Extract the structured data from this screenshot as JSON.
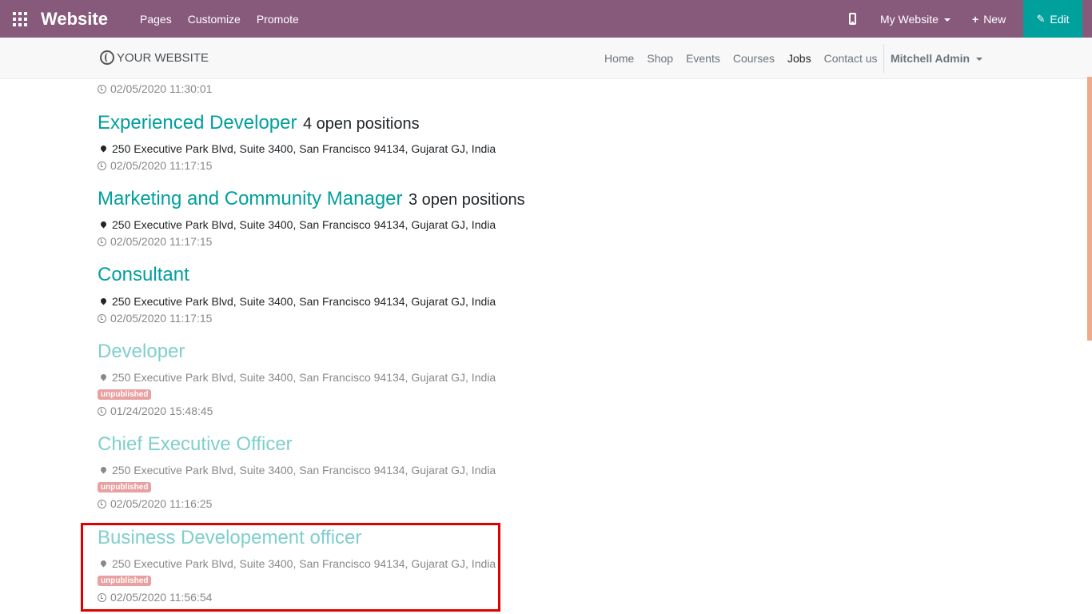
{
  "topbar": {
    "app_title": "Website",
    "menu": [
      "Pages",
      "Customize",
      "Promote"
    ],
    "website_selector": "My Website",
    "new_label": "New",
    "edit_label": "Edit",
    "icons": [
      "apps-icon",
      "mobile-icon",
      "plus-icon",
      "pencil-icon",
      "caret-down-icon"
    ]
  },
  "header": {
    "logo_text": "YOUR WEBSITE",
    "nav": [
      "Home",
      "Shop",
      "Events",
      "Courses",
      "Jobs",
      "Contact us"
    ],
    "active_nav": "Jobs",
    "user": "Mitchell Admin"
  },
  "partial_top_date": "02/05/2020 11:30:01",
  "jobs": [
    {
      "title": "Experienced Developer",
      "positions": "4 open positions",
      "address": "250 Executive Park Blvd, Suite 3400, San Francisco 94134, Gujarat GJ, India",
      "date": "02/05/2020 11:17:15",
      "published": true
    },
    {
      "title": "Marketing and Community Manager",
      "positions": "3 open positions",
      "address": "250 Executive Park Blvd, Suite 3400, San Francisco 94134, Gujarat GJ, India",
      "date": "02/05/2020 11:17:15",
      "published": true
    },
    {
      "title": "Consultant",
      "positions": "",
      "address": "250 Executive Park Blvd, Suite 3400, San Francisco 94134, Gujarat GJ, India",
      "date": "02/05/2020 11:17:15",
      "published": true
    },
    {
      "title": "Developer",
      "positions": "",
      "address": "250 Executive Park Blvd, Suite 3400, San Francisco 94134, Gujarat GJ, India",
      "badge": "unpublished",
      "date": "01/24/2020 15:48:45",
      "published": false
    },
    {
      "title": "Chief Executive Officer",
      "positions": "",
      "address": "250 Executive Park Blvd, Suite 3400, San Francisco 94134, Gujarat GJ, India",
      "badge": "unpublished",
      "date": "02/05/2020 11:16:25",
      "published": false
    },
    {
      "title": "Business Developement officer",
      "positions": "",
      "address": "250 Executive Park Blvd, Suite 3400, San Francisco 94134, Gujarat GJ, India",
      "badge": "unpublished",
      "date": "02/05/2020 11:56:54",
      "published": false
    }
  ],
  "colors": {
    "topbar": "#875a7b",
    "edit_button": "#00a09d",
    "title_published": "#00a09d",
    "title_unpublished": "#7fcfcd",
    "badge": "#eaa0a0",
    "highlight_box": "#e00000"
  }
}
